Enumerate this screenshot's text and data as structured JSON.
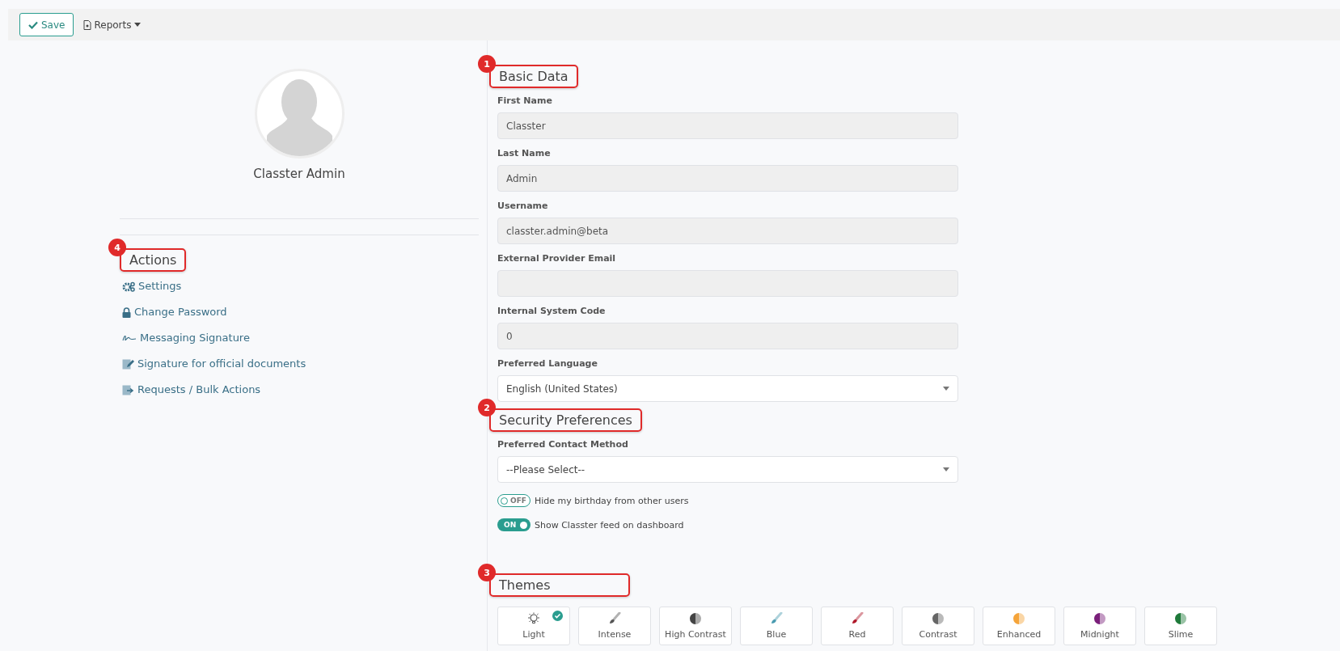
{
  "toolbar": {
    "save": "Save",
    "reports": "Reports"
  },
  "profile": {
    "name": "Classter Admin"
  },
  "actions": {
    "title": "Actions",
    "callout": "4",
    "items": [
      {
        "kind": "gears",
        "label": "Settings"
      },
      {
        "kind": "lock",
        "label": "Change Password"
      },
      {
        "kind": "signature",
        "label": "Messaging Signature"
      },
      {
        "kind": "doc-edit",
        "label": "Signature for official documents"
      },
      {
        "kind": "doc-arrow",
        "label": "Requests / Bulk Actions"
      }
    ]
  },
  "basic_data": {
    "title": "Basic Data",
    "callout": "1",
    "fields": [
      {
        "kind": "text",
        "label": "First Name",
        "value": "Classter",
        "disabled": true
      },
      {
        "kind": "text",
        "label": "Last Name",
        "value": "Admin",
        "disabled": true
      },
      {
        "kind": "text",
        "label": "Username",
        "value": "classter.admin@beta",
        "disabled": true
      },
      {
        "kind": "text",
        "label": "External Provider Email",
        "disabled": true
      },
      {
        "kind": "text",
        "label": "Internal System Code",
        "value": "0",
        "disabled": true
      },
      {
        "kind": "select",
        "label": "Preferred Language",
        "value": "English (United States)",
        "disabled": false
      }
    ]
  },
  "security": {
    "title": "Security Preferences",
    "callout": "2",
    "fields": [
      {
        "kind": "select",
        "label": "Preferred Contact Method",
        "value": "--Please Select--",
        "disabled": false
      }
    ],
    "toggles": [
      {
        "label": "Hide my birthday from other users",
        "on": false,
        "state_text": "OFF"
      },
      {
        "label": "Show Classter feed on dashboard",
        "on": true,
        "state_text": "ON"
      }
    ]
  },
  "themes": {
    "title": "Themes",
    "callout": "3",
    "items": [
      {
        "kind": "bulb",
        "label": "Light",
        "selected": true
      },
      {
        "kind": "brush",
        "label": "Intense",
        "color": "#555555",
        "selected": false
      },
      {
        "kind": "half",
        "label": "High Contrast",
        "color": "#444444",
        "selected": false
      },
      {
        "kind": "brush",
        "label": "Blue",
        "color": "#4a9bb0",
        "selected": false
      },
      {
        "kind": "brush",
        "label": "Red",
        "color": "#b0182a",
        "selected": false
      },
      {
        "kind": "half",
        "label": "Contrast",
        "color": "#666666",
        "selected": false
      },
      {
        "kind": "half",
        "label": "Enhanced",
        "color": "#f5a43a",
        "selected": false
      },
      {
        "kind": "half",
        "label": "Midnight",
        "color": "#7a1f7a",
        "selected": false
      },
      {
        "kind": "half",
        "label": "Slime",
        "color": "#1f7a3a",
        "selected": false
      }
    ]
  }
}
